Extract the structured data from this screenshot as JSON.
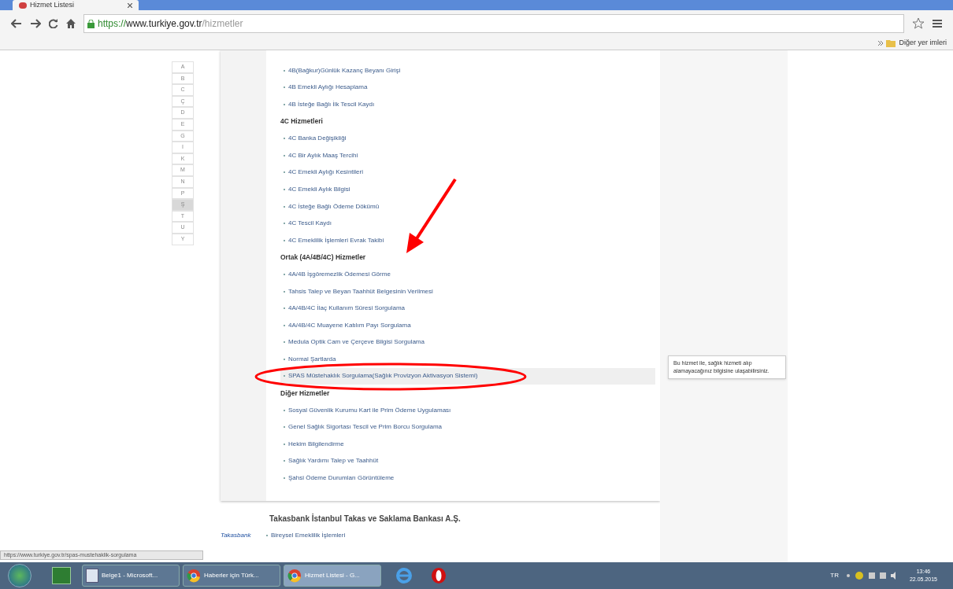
{
  "browser": {
    "tab_title": "Hizmet Listesi",
    "url_scheme": "https://",
    "url_host": "www.turkiye.gov.tr",
    "url_path": "/hizmetler",
    "bookmarks_folder": "Diğer yer imleri"
  },
  "letters": [
    {
      "label": "A",
      "selected": false
    },
    {
      "label": "B",
      "selected": false
    },
    {
      "label": "C",
      "selected": false
    },
    {
      "label": "Ç",
      "selected": false
    },
    {
      "label": "D",
      "selected": false
    },
    {
      "label": "E",
      "selected": false
    },
    {
      "label": "G",
      "selected": false
    },
    {
      "label": "I",
      "selected": false
    },
    {
      "label": "K",
      "selected": false
    },
    {
      "label": "M",
      "selected": false
    },
    {
      "label": "N",
      "selected": false
    },
    {
      "label": "P",
      "selected": false
    },
    {
      "label": "Ş",
      "selected": true
    },
    {
      "label": "T",
      "selected": false
    },
    {
      "label": "U",
      "selected": false
    },
    {
      "label": "Y",
      "selected": false
    }
  ],
  "sections": [
    {
      "items": [
        {
          "label": "4B(Bağkur)Günlük Kazanç Beyanı Girişi",
          "hovered": false
        },
        {
          "label": "4B Emekli Aylığı Hesaplama",
          "hovered": false
        },
        {
          "label": "4B İsteğe Bağlı İlk Tescil Kaydı",
          "hovered": false
        }
      ]
    },
    {
      "heading": "4C Hizmetleri",
      "items": [
        {
          "label": "4C Banka Değişikliği",
          "hovered": false
        },
        {
          "label": "4C Bir Aylık Maaş Tercihi",
          "hovered": false
        },
        {
          "label": "4C Emekli Aylığı Kesintileri",
          "hovered": false
        },
        {
          "label": "4C Emekli Aylık Bilgisi",
          "hovered": false
        },
        {
          "label": "4C İsteğe Bağlı Ödeme Dökümü",
          "hovered": false
        },
        {
          "label": "4C Tescil Kaydı",
          "hovered": false
        },
        {
          "label": "4C Emeklilik İşlemleri Evrak Takibi",
          "hovered": false
        }
      ]
    },
    {
      "heading": "Ortak (4A/4B/4C) Hizmetler",
      "items": [
        {
          "label": "4A/4B İşgöremezlik Ödemesi Görme",
          "hovered": false
        },
        {
          "label": "Tahsis Talep ve Beyan Taahhüt Belgesinin Verilmesi",
          "hovered": false
        },
        {
          "label": "4A/4B/4C İlaç Kullanım Süresi Sorgulama",
          "hovered": false
        },
        {
          "label": "4A/4B/4C Muayene Katılım Payı Sorgulama",
          "hovered": false
        },
        {
          "label": "Medula Optik Cam ve Çerçeve Bilgisi Sorgulama",
          "hovered": false
        },
        {
          "label": "Normal Şartlarda",
          "hovered": false
        },
        {
          "label": "SPAS Müstehaklık Sorgulama(Sağlık Provizyon Aktivasyon Sistemi)",
          "hovered": true
        }
      ]
    },
    {
      "heading": "Diğer Hizmetler",
      "items": [
        {
          "label": "Sosyal Güvenlik Kurumu Kart ile Prim Ödeme Uygulaması",
          "hovered": false
        },
        {
          "label": "Genel Sağlık Sigortası Tescil ve Prim Borcu Sorgulama",
          "hovered": false
        },
        {
          "label": "Hekim Bilgilendirme",
          "hovered": false
        },
        {
          "label": "Sağlık Yardımı Talep ve Taahhüt",
          "hovered": false
        },
        {
          "label": "Şahsi Ödeme Durumları Görüntüleme",
          "hovered": false
        }
      ]
    }
  ],
  "tooltip": "Bu hizmet ile, sağlık hizmeti alıp alamayacağınız bilgisine ulaşabilirsiniz.",
  "next_institution": {
    "logo": "Takasbank",
    "heading": "Takasbank İstanbul Takas ve Saklama Bankası A.Ş.",
    "items": [
      "Bireysel Emeklilik İşlemleri"
    ]
  },
  "status_url": "https://www.turkiye.gov.tr/spas-mustehaklik-sorgulama",
  "taskbar": {
    "windows": [
      {
        "label": "Belge1 - Microsoft...",
        "kind": "word",
        "selected": false
      },
      {
        "label": "Haberler için Türk...",
        "kind": "chrome",
        "selected": false
      },
      {
        "label": "Hizmet Listesi - G...",
        "kind": "chrome",
        "selected": true
      }
    ],
    "language": "TR",
    "time": "13:46",
    "date": "22.05.2015"
  }
}
